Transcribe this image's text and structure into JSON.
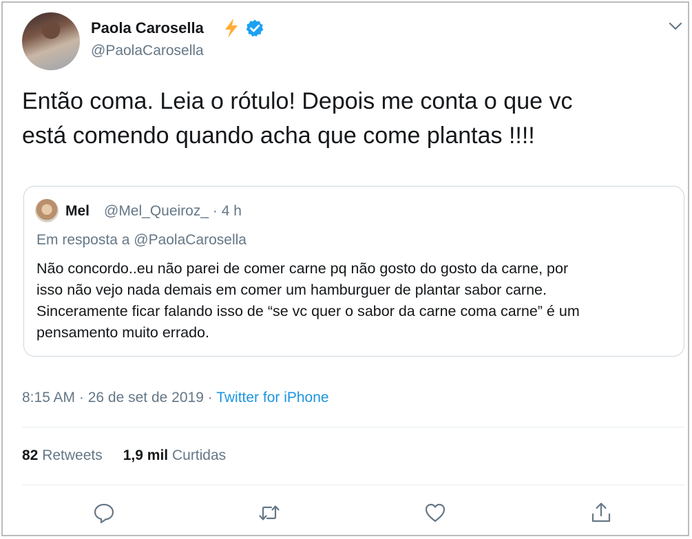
{
  "author": {
    "name": "Paola Carosella",
    "handle": "@PaolaCarosella"
  },
  "tweet": {
    "text_line1": "Então coma. Leia o rótulo! Depois me conta o que vc",
    "text_line2": "está comendo quando acha que come plantas !!!!"
  },
  "quoted": {
    "name": "Mel",
    "handle": "@Mel_Queiroz_",
    "time": "4 h",
    "reply_prefix": "Em resposta a",
    "reply_to": "@PaolaCarosella",
    "text_line1": "Não concordo..eu não parei de comer carne pq não gosto do gosto da carne, por",
    "text_line2": "isso não vejo nada demais em comer um hamburguer de plantar sabor carne.",
    "text_line3": "Sinceramente ficar falando isso de “se vc quer o sabor da carne coma carne” é um",
    "text_line4": "pensamento muito errado."
  },
  "meta": {
    "time": "8:15 AM",
    "date": "26 de set de 2019",
    "source": "Twitter for iPhone"
  },
  "stats": {
    "retweets_count": "82",
    "retweets_label": "Retweets",
    "likes_count": "1,9 mil",
    "likes_label": "Curtidas"
  },
  "icons": {
    "bolt": "lightning-bolt-icon",
    "verified": "verified-badge-icon",
    "caret": "chevron-down-icon",
    "reply": "reply-icon",
    "retweet": "retweet-icon",
    "like": "heart-icon",
    "share": "share-icon"
  },
  "colors": {
    "text": "#14171a",
    "secondary": "#657786",
    "link": "#1b95e0",
    "verified": "#1da1f2",
    "bolt": "#ffac33"
  }
}
